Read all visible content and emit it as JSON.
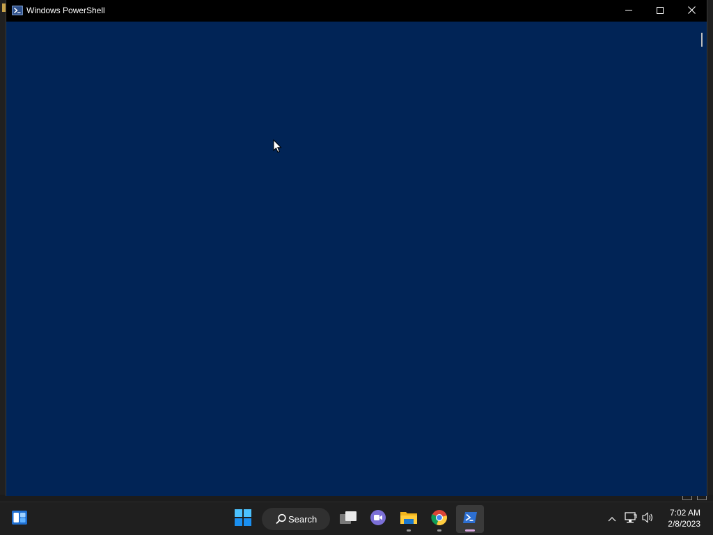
{
  "window": {
    "title": "Windows PowerShell",
    "icon": "powershell-icon",
    "console_background": "#012456",
    "controls": [
      "minimize-icon",
      "maximize-icon",
      "close-icon"
    ]
  },
  "taskbar": {
    "search_label": "Search",
    "apps": [
      "widgets-icon",
      "start-icon",
      "task-view-icon",
      "chat-icon",
      "file-explorer-icon",
      "chrome-icon",
      "powershell-icon"
    ],
    "active_app": "powershell",
    "clock": {
      "time": "7:02 AM",
      "date": "2/8/2023"
    }
  }
}
